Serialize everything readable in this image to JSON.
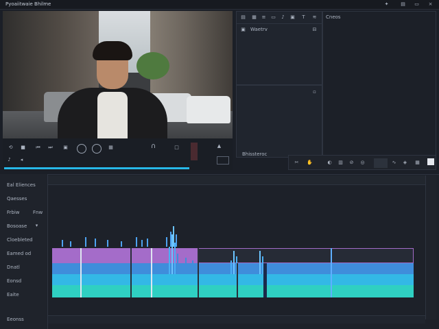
{
  "app": {
    "title": "Pyoaiitwaie Bhilme"
  },
  "media_panel": {
    "item_label": "Waetrv"
  },
  "viewer_panel": {
    "label": "Cneos"
  },
  "effects_label": "Bhissteroc",
  "timeline": {
    "track_labels": [
      "Eal Eliences",
      "Qaesses",
      "Frbiw",
      "Bosoase",
      "Cloebleted",
      "Eamed od",
      "Dnatl",
      "Eonsd",
      "Eaite",
      "Eeonss"
    ],
    "header_right": "Fnw"
  },
  "colors": {
    "accent": "#27b8e8",
    "clip_purple": "#a46cc9",
    "clip_blue": "#3f8ddb",
    "clip_cyan": "#33b8e6",
    "clip_teal": "#2fd0c2"
  }
}
